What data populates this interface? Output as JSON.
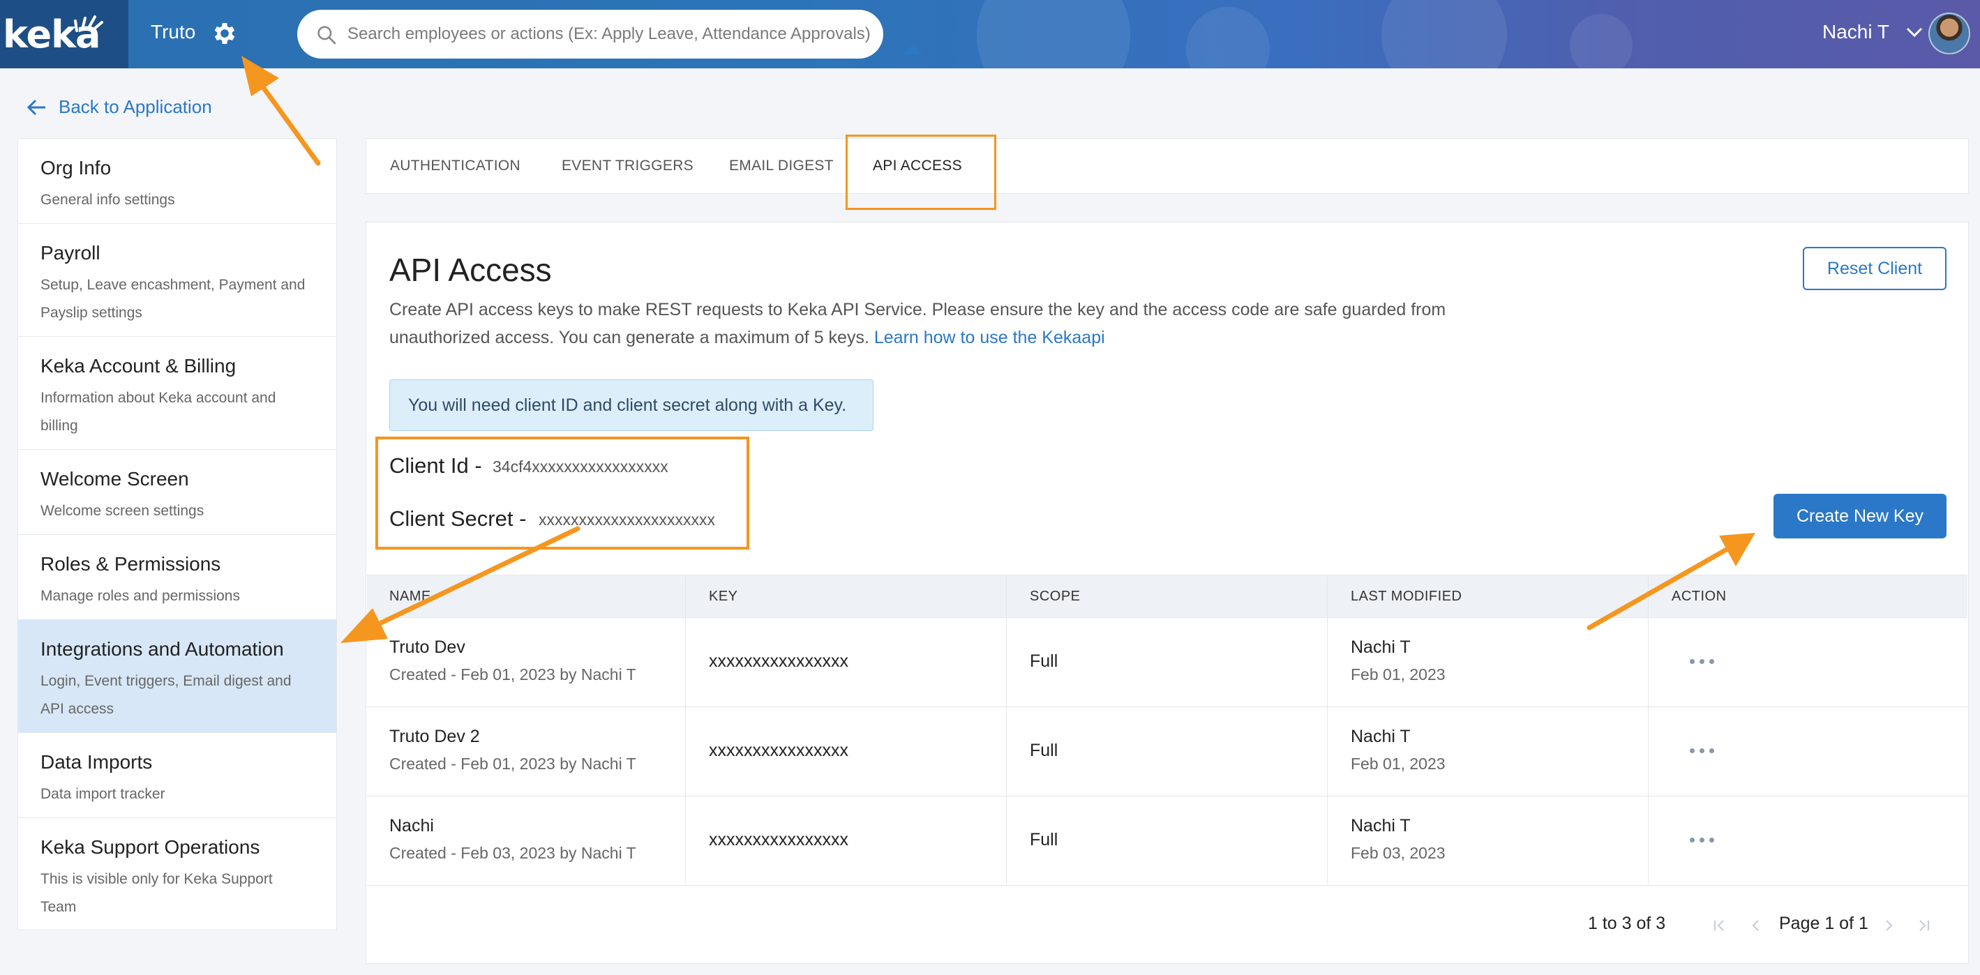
{
  "topbar": {
    "logo_text": "keka",
    "org_name": "Truto",
    "search_placeholder": "Search employees or actions (Ex: Apply Leave, Attendance Approvals)",
    "user_name": "Nachi T"
  },
  "back_link": {
    "label": "Back to Application"
  },
  "sidebar": {
    "items": [
      {
        "title": "Org Info",
        "subtitle_lines": [
          "General info settings"
        ]
      },
      {
        "title": "Payroll",
        "subtitle_lines": [
          "Setup, Leave encashment, Payment and",
          "Payslip settings"
        ]
      },
      {
        "title": "Keka Account & Billing",
        "subtitle_lines": [
          "Information about Keka account and",
          "billing"
        ]
      },
      {
        "title": "Welcome Screen",
        "subtitle_lines": [
          "Welcome screen settings"
        ]
      },
      {
        "title": "Roles & Permissions",
        "subtitle_lines": [
          "Manage roles and permissions"
        ]
      },
      {
        "title": "Integrations and Automation",
        "subtitle_lines": [
          "Login, Event triggers, Email digest and",
          "API access"
        ],
        "active": true
      },
      {
        "title": "Data Imports",
        "subtitle_lines": [
          "Data import tracker"
        ]
      },
      {
        "title": "Keka Support Operations",
        "subtitle_lines": [
          "This is visible only for Keka Support",
          "Team"
        ]
      }
    ]
  },
  "tabs": [
    {
      "label": "AUTHENTICATION"
    },
    {
      "label": "EVENT TRIGGERS"
    },
    {
      "label": "EMAIL DIGEST"
    },
    {
      "label": "API ACCESS",
      "active": true
    }
  ],
  "main": {
    "title": "API Access",
    "description_line1": "Create API access keys to make REST requests to Keka API Service. Please ensure the key and the access code are safe guarded from",
    "description_line2": "unauthorized access. You can generate a maximum of 5 keys.",
    "learn_link": "Learn how to use the Kekaapi",
    "reset_button": "Reset Client",
    "info_banner": "You will need client ID and client secret along with a Key.",
    "client_id_label": "Client Id -",
    "client_id_value": "34cf4xxxxxxxxxxxxxxxxx",
    "client_secret_label": "Client Secret -",
    "client_secret_value": "xxxxxxxxxxxxxxxxxxxxxx",
    "create_button": "Create New Key"
  },
  "table": {
    "headers": [
      "NAME",
      "KEY",
      "SCOPE",
      "LAST MODIFIED",
      "ACTION"
    ],
    "rows": [
      {
        "name": "Truto Dev",
        "created": "Created - Feb 01, 2023 by Nachi T",
        "key": "xxxxxxxxxxxxxxxx",
        "scope": "Full",
        "modified_by": "Nachi T",
        "modified_date": "Feb 01, 2023"
      },
      {
        "name": "Truto Dev 2",
        "created": "Created - Feb 01, 2023 by Nachi T",
        "key": "xxxxxxxxxxxxxxxx",
        "scope": "Full",
        "modified_by": "Nachi T",
        "modified_date": "Feb 01, 2023"
      },
      {
        "name": "Nachi",
        "created": "Created - Feb 03, 2023 by Nachi T",
        "key": "xxxxxxxxxxxxxxxx",
        "scope": "Full",
        "modified_by": "Nachi T",
        "modified_date": "Feb 03, 2023"
      }
    ]
  },
  "pagination": {
    "count": "1 to 3 of 3",
    "page_text": "Page 1 of 1"
  },
  "colors": {
    "accent": "#2a78c7",
    "annotation": "#f5961f",
    "active_bg": "#d7e7f7"
  }
}
